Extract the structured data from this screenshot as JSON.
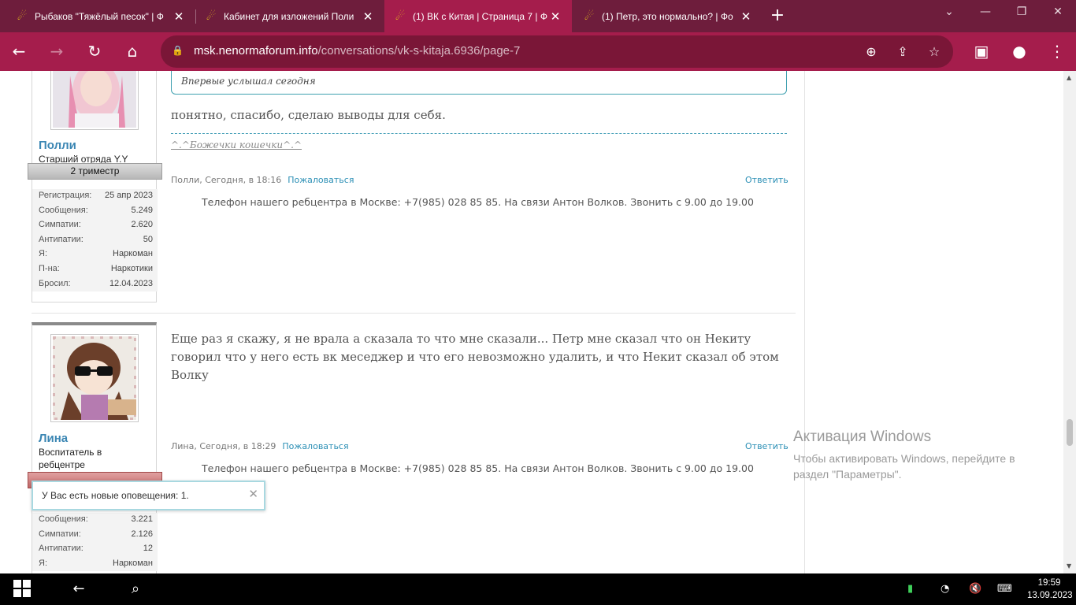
{
  "browser": {
    "tabs": [
      {
        "title": "Рыбаков \"Тяжёлый песок\" | Ф"
      },
      {
        "title": "Кабинет для изложений Поли"
      },
      {
        "title": "(1) ВК с Китая | Страница 7 | Ф"
      },
      {
        "title": "(1) Петр, это нормально? | Фо"
      }
    ],
    "url_domain": "msk.nenormaforum.info",
    "url_path": "/conversations/vk-s-kitaja.6936/page-7"
  },
  "post1": {
    "quote_text": "Впервые услышал сегодня",
    "message": "понятно, спасибо, сделаю выводы для себя.",
    "signature": "^.^Божечки кошечки^.^",
    "meta": "Полли, Сегодня, в 18:16",
    "report": "Пожаловаться",
    "reply": "Ответить",
    "ad": "Телефон нашего ребцентра в Москве: +7(985) 028 85 85. На связи Антон Волков. Звонить с 9.00 до 19.00",
    "user": {
      "name": "Полли",
      "title": "Старший отряда Y.Y",
      "ribbon": "2 триместр",
      "stats": [
        {
          "k": "Регистрация:",
          "v": "25 апр 2023"
        },
        {
          "k": "Сообщения:",
          "v": "5.249"
        },
        {
          "k": "Симпатии:",
          "v": "2.620"
        },
        {
          "k": "Антипатии:",
          "v": "50"
        },
        {
          "k": "Я:",
          "v": "Наркоман"
        },
        {
          "k": "П-на:",
          "v": "Наркотики"
        },
        {
          "k": "Бросил:",
          "v": "12.04.2023"
        }
      ]
    }
  },
  "post2": {
    "message": "Еще раз я скажу, я не врала а сказала то что мне сказали... Петр мне сказал что он Некиту говорил что у него есть вк меседжер и что его невозможно удалить, и что Некит сказал об этом Волку",
    "meta": "Лина, Сегодня, в 18:29",
    "report": "Пожаловаться",
    "reply": "Ответить",
    "ad": "Телефон нашего ребцентра в Москве: +7(985) 028 85 85. На связи Антон Волков. Звонить с 9.00 до 19.00",
    "user": {
      "name": "Лина",
      "title": "Воспитатель в ребцентре",
      "stats": [
        {
          "k": "Сообщения:",
          "v": "3.221"
        },
        {
          "k": "Симпатии:",
          "v": "2.126"
        },
        {
          "k": "Антипатии:",
          "v": "12"
        },
        {
          "k": "Я:",
          "v": "Наркоман"
        }
      ]
    }
  },
  "notification": {
    "text": "У Вас есть новые оповещения: 1."
  },
  "activation": {
    "heading": "Активация Windows",
    "line1": "Чтобы активировать Windows, перейдите в",
    "line2": "раздел \"Параметры\"."
  },
  "taskbar": {
    "time": "19:59",
    "date": "13.09.2023"
  },
  "colors": {
    "tabstrip": "#6e1d3c",
    "toolbar": "#a51d4c",
    "link": "#2b8fb5",
    "username": "#3b86b3"
  }
}
